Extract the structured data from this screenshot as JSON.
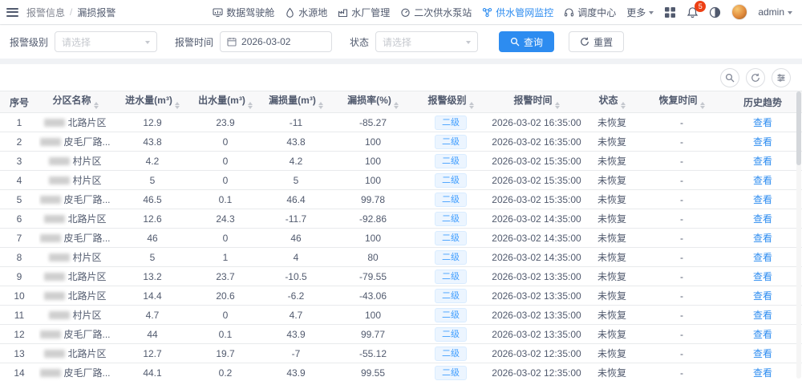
{
  "header": {
    "breadcrumb": [
      "报警信息",
      "漏损报警"
    ],
    "nav": [
      {
        "label": "数据驾驶舱"
      },
      {
        "label": "水源地"
      },
      {
        "label": "水厂管理"
      },
      {
        "label": "二次供水泵站"
      },
      {
        "label": "供水管网监控",
        "active": true
      },
      {
        "label": "调度中心"
      },
      {
        "label": "更多"
      }
    ],
    "notification_count": "5",
    "user": "admin"
  },
  "filters": {
    "level_label": "报警级别",
    "level_placeholder": "请选择",
    "time_label": "报警时间",
    "time_value": "2026-03-02",
    "status_label": "状态",
    "status_placeholder": "请选择",
    "query_button": "查询",
    "reset_button": "重置"
  },
  "table": {
    "columns": [
      "序号",
      "分区名称",
      "进水量(m³)",
      "出水量(m³)",
      "漏损量(m³)",
      "漏损率(%)",
      "报警级别",
      "报警时间",
      "状态",
      "恢复时间",
      "历史趋势"
    ],
    "rows": [
      {
        "no": "1",
        "zone": "北路片区",
        "inflow": "12.9",
        "outflow": "23.9",
        "loss": "-11",
        "rate": "-85.27",
        "level": "二级",
        "time": "2026-03-02 16:35:00",
        "status": "未恢复",
        "recover": "-",
        "action": "查看"
      },
      {
        "no": "2",
        "zone": "皮毛厂路...",
        "inflow": "43.8",
        "outflow": "0",
        "loss": "43.8",
        "rate": "100",
        "level": "二级",
        "time": "2026-03-02 16:35:00",
        "status": "未恢复",
        "recover": "-",
        "action": "查看"
      },
      {
        "no": "3",
        "zone": "村片区",
        "inflow": "4.2",
        "outflow": "0",
        "loss": "4.2",
        "rate": "100",
        "level": "二级",
        "time": "2026-03-02 15:35:00",
        "status": "未恢复",
        "recover": "-",
        "action": "查看"
      },
      {
        "no": "4",
        "zone": "村片区",
        "inflow": "5",
        "outflow": "0",
        "loss": "5",
        "rate": "100",
        "level": "二级",
        "time": "2026-03-02 15:35:00",
        "status": "未恢复",
        "recover": "-",
        "action": "查看"
      },
      {
        "no": "5",
        "zone": "皮毛厂路...",
        "inflow": "46.5",
        "outflow": "0.1",
        "loss": "46.4",
        "rate": "99.78",
        "level": "二级",
        "time": "2026-03-02 15:35:00",
        "status": "未恢复",
        "recover": "-",
        "action": "查看"
      },
      {
        "no": "6",
        "zone": "北路片区",
        "inflow": "12.6",
        "outflow": "24.3",
        "loss": "-11.7",
        "rate": "-92.86",
        "level": "二级",
        "time": "2026-03-02 14:35:00",
        "status": "未恢复",
        "recover": "-",
        "action": "查看"
      },
      {
        "no": "7",
        "zone": "皮毛厂路...",
        "inflow": "46",
        "outflow": "0",
        "loss": "46",
        "rate": "100",
        "level": "二级",
        "time": "2026-03-02 14:35:00",
        "status": "未恢复",
        "recover": "-",
        "action": "查看"
      },
      {
        "no": "8",
        "zone": "村片区",
        "inflow": "5",
        "outflow": "1",
        "loss": "4",
        "rate": "80",
        "level": "二级",
        "time": "2026-03-02 14:35:00",
        "status": "未恢复",
        "recover": "-",
        "action": "查看"
      },
      {
        "no": "9",
        "zone": "北路片区",
        "inflow": "13.2",
        "outflow": "23.7",
        "loss": "-10.5",
        "rate": "-79.55",
        "level": "二级",
        "time": "2026-03-02 13:35:00",
        "status": "未恢复",
        "recover": "-",
        "action": "查看"
      },
      {
        "no": "10",
        "zone": "北路片区",
        "inflow": "14.4",
        "outflow": "20.6",
        "loss": "-6.2",
        "rate": "-43.06",
        "level": "二级",
        "time": "2026-03-02 13:35:00",
        "status": "未恢复",
        "recover": "-",
        "action": "查看"
      },
      {
        "no": "11",
        "zone": "村片区",
        "inflow": "4.7",
        "outflow": "0",
        "loss": "4.7",
        "rate": "100",
        "level": "二级",
        "time": "2026-03-02 13:35:00",
        "status": "未恢复",
        "recover": "-",
        "action": "查看"
      },
      {
        "no": "12",
        "zone": "皮毛厂路...",
        "inflow": "44",
        "outflow": "0.1",
        "loss": "43.9",
        "rate": "99.77",
        "level": "二级",
        "time": "2026-03-02 13:35:00",
        "status": "未恢复",
        "recover": "-",
        "action": "查看"
      },
      {
        "no": "13",
        "zone": "北路片区",
        "inflow": "12.7",
        "outflow": "19.7",
        "loss": "-7",
        "rate": "-55.12",
        "level": "二级",
        "time": "2026-03-02 12:35:00",
        "status": "未恢复",
        "recover": "-",
        "action": "查看"
      },
      {
        "no": "14",
        "zone": "皮毛厂路...",
        "inflow": "44.1",
        "outflow": "0.2",
        "loss": "43.9",
        "rate": "99.55",
        "level": "二级",
        "time": "2026-03-02 12:35:00",
        "status": "未恢复",
        "recover": "-",
        "action": "查看"
      }
    ]
  },
  "colors": {
    "accent": "#2d8cf0",
    "badge_red": "#ed4014",
    "tag_blue": "#409eff"
  }
}
